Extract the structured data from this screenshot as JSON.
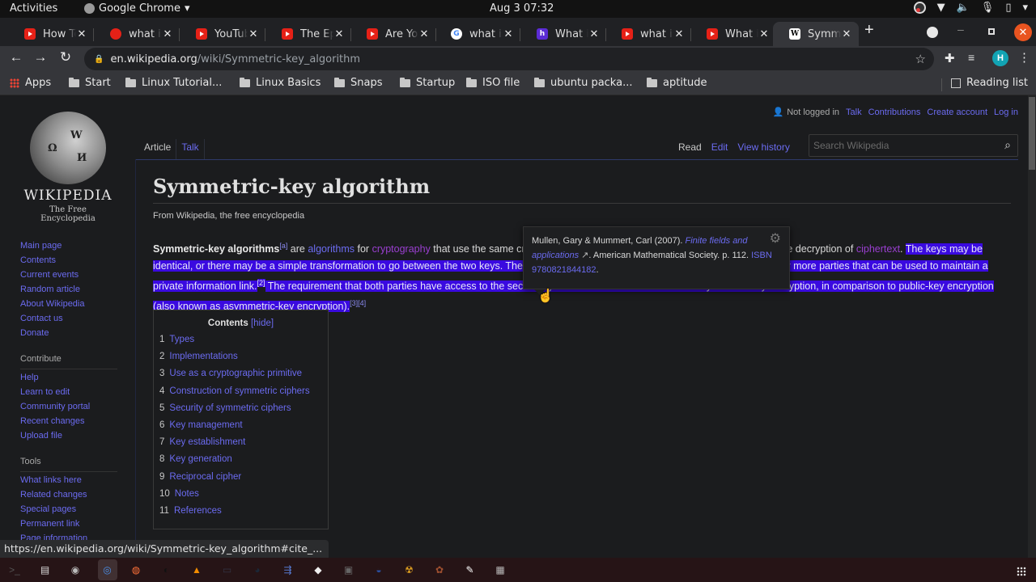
{
  "system": {
    "activities": "Activities",
    "app_name": "Google Chrome",
    "clock": "Aug 3  07:32"
  },
  "browser": {
    "tabs": [
      {
        "title": "How To",
        "favicon": "youtube-icon"
      },
      {
        "title": "what is",
        "favicon": "reddit-icon"
      },
      {
        "title": "YouTube",
        "favicon": "youtube-icon"
      },
      {
        "title": "The Ep",
        "favicon": "youtube-icon"
      },
      {
        "title": "Are You",
        "favicon": "youtube-icon"
      },
      {
        "title": "what is",
        "favicon": "google-icon"
      },
      {
        "title": "What is",
        "favicon": "h-icon"
      },
      {
        "title": "what is",
        "favicon": "youtube-icon"
      },
      {
        "title": "What is",
        "favicon": "youtube-icon"
      },
      {
        "title": "Symmetric",
        "favicon": "wikipedia-icon",
        "active": true
      }
    ],
    "url_host": "en.wikipedia.org",
    "url_path": "/wiki/Symmetric-key_algorithm",
    "avatar_letter": "H",
    "bookmarks": [
      "Apps",
      "Start",
      "Linux Tutorial...",
      "Linux Basics",
      "Snaps",
      "Startup",
      "ISO file",
      "ubuntu packa...",
      "aptitude"
    ],
    "reading_list": "Reading list",
    "status_url": "https://en.wikipedia.org/wiki/Symmetric-key_algorithm#cite_..."
  },
  "wiki": {
    "wordmark": "WIKIPEDIA",
    "tagline": "The Free Encyclopedia",
    "user": {
      "not_logged_in": "Not logged in",
      "links": [
        "Talk",
        "Contributions",
        "Create account",
        "Log in"
      ]
    },
    "tabs_left": [
      "Article",
      "Talk"
    ],
    "tabs_right": [
      "Read",
      "Edit",
      "View history"
    ],
    "search_placeholder": "Search Wikipedia",
    "sidebar": {
      "nav": [
        "Main page",
        "Contents",
        "Current events",
        "Random article",
        "About Wikipedia",
        "Contact us",
        "Donate"
      ],
      "contribute_heading": "Contribute",
      "contribute": [
        "Help",
        "Learn to edit",
        "Community portal",
        "Recent changes",
        "Upload file"
      ],
      "tools_heading": "Tools",
      "tools": [
        "What links here",
        "Related changes",
        "Special pages",
        "Permanent link",
        "Page information"
      ]
    },
    "title": "Symmetric-key algorithm",
    "from": "From Wikipedia, the free encyclopedia",
    "lead": {
      "bold": "Symmetric-key algorithms",
      "note_a": "[a]",
      "t1": " are ",
      "link_algorithms": "algorithms",
      "t2": " for ",
      "link_cryptography": "cryptography",
      "t3": " that use the same cryptographic keys for both the encryption of plaintext and the decryption of ",
      "link_ciphertext": "ciphertext",
      "t4": ". ",
      "selected1": "The keys may be identical, or there may be a simple transformation to go between the two keys. The keys, in practice, represent a shared secret between two or more parties that can be used to maintain a private information link.",
      "ref2": "[2]",
      "selected2": " The requirement that both parties have access to the secret key is one of the main drawbacks of symmetric-key encryption, in comparison to public-key encryption (also known as asymmetric-key encryption).",
      "ref34": "[3][4]"
    },
    "tooltip": {
      "authors": "Mullen, Gary & Mummert, Carl (2007). ",
      "book": "Finite fields and applications",
      "publisher": ". American Mathematical Society. p. 112. ",
      "isbn": "ISBN 9780821844182",
      "end": "."
    },
    "toc": {
      "title": "Contents",
      "hide": "[hide]",
      "items": [
        {
          "num": "1",
          "text": "Types"
        },
        {
          "num": "2",
          "text": "Implementations"
        },
        {
          "num": "3",
          "text": "Use as a cryptographic primitive"
        },
        {
          "num": "4",
          "text": "Construction of symmetric ciphers"
        },
        {
          "num": "5",
          "text": "Security of symmetric ciphers"
        },
        {
          "num": "6",
          "text": "Key management"
        },
        {
          "num": "7",
          "text": "Key establishment"
        },
        {
          "num": "8",
          "text": "Key generation"
        },
        {
          "num": "9",
          "text": "Reciprocal cipher"
        },
        {
          "num": "10",
          "text": "Notes"
        },
        {
          "num": "11",
          "text": "References"
        }
      ]
    }
  },
  "dock": [
    "terminal-icon",
    "files-icon",
    "disks-icon",
    "chrome-icon",
    "firefox-icon",
    "obs-icon",
    "vlc-icon",
    "monitor-icon",
    "steam-icon",
    "kdeconnect-icon",
    "vscode-icon",
    "gimp-icon",
    "keepass-icon",
    "warning-app-icon",
    "app-icon",
    "text-editor-icon",
    "trash-icon"
  ]
}
